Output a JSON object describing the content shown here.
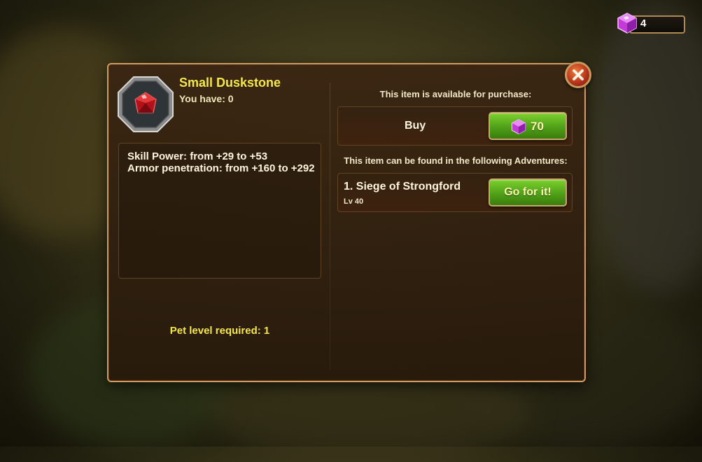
{
  "currency": {
    "icon": "gem-icon",
    "amount": "4"
  },
  "item": {
    "name": "Small Duskstone",
    "you_have": "You have: 0",
    "icon": "red-gem-icon",
    "stats": [
      "Skill Power: from +29 to +53",
      "Armor penetration: from +160 to +292"
    ],
    "pet_level": "Pet level required: 1"
  },
  "purchase": {
    "heading": "This item is available for purchase:",
    "buy_label": "Buy",
    "price_icon": "gem-icon",
    "price": "70"
  },
  "adventures": {
    "heading": "This item can be found in the following Adventures:",
    "items": [
      {
        "name": "1. Siege of Strongford",
        "level": "Lv 40",
        "button": "Go for it!"
      }
    ]
  },
  "colors": {
    "accent_yellow": "#f5e64a",
    "frame_gold": "#d09a62",
    "button_green": "#4fa018",
    "close_red": "#b0301a"
  }
}
